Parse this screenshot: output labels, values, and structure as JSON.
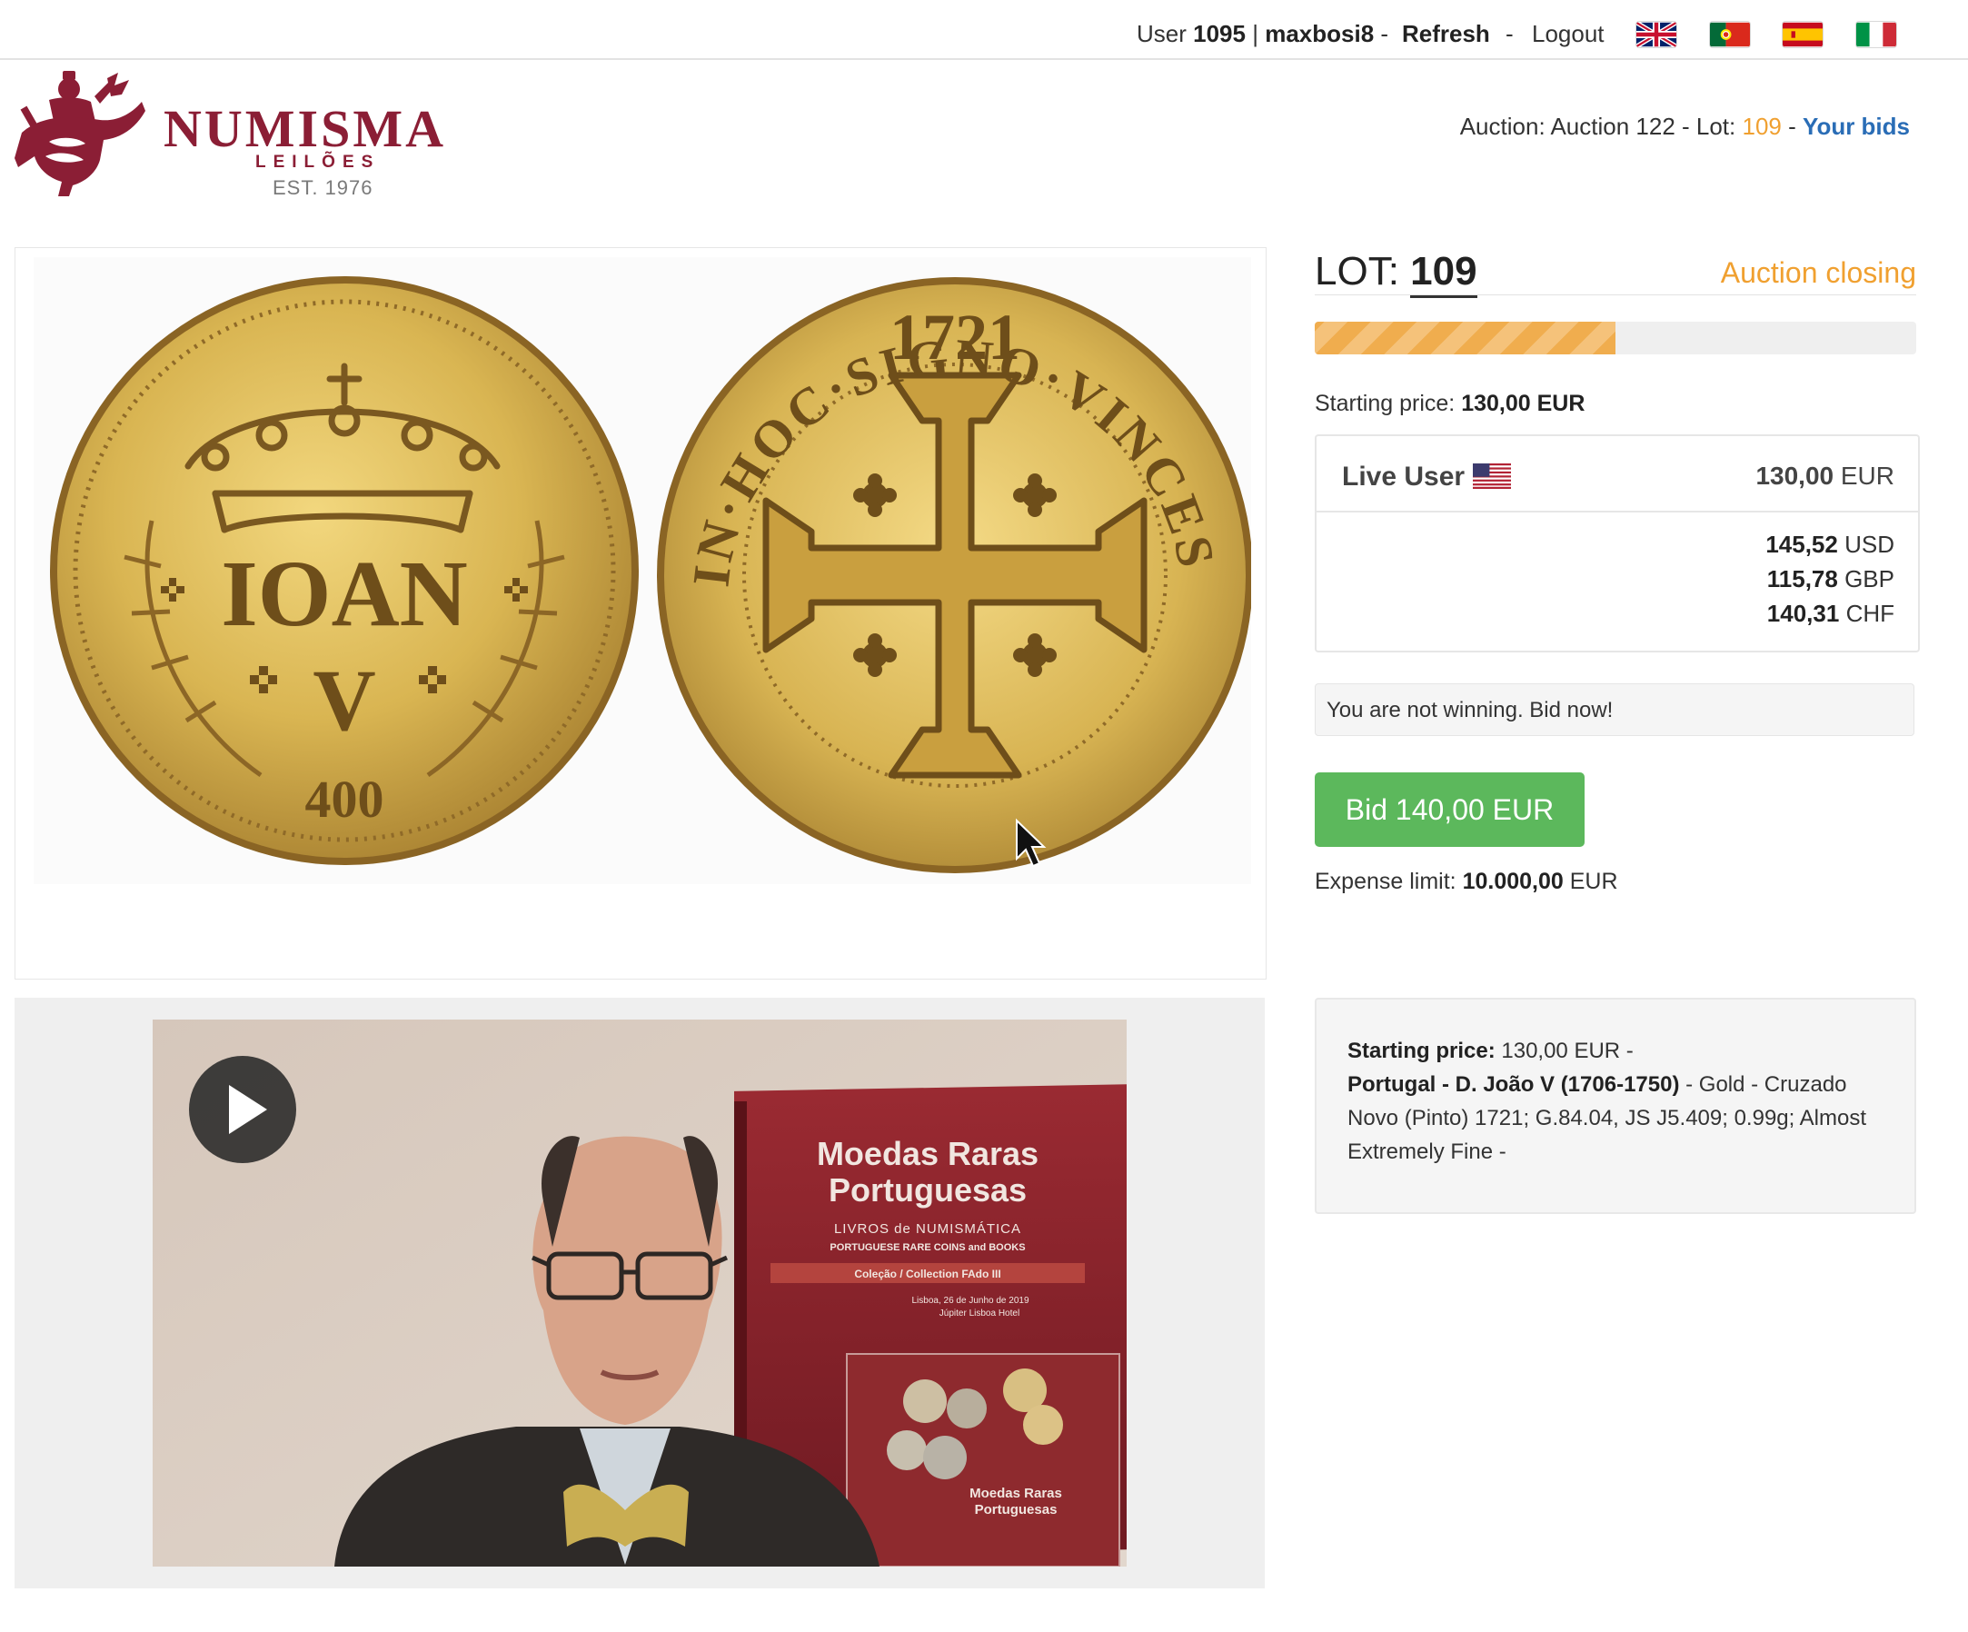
{
  "topbar": {
    "user_prefix": "User",
    "user_id": "1095",
    "separator": "|",
    "username": "maxbosi8",
    "dash1": "-",
    "refresh": "Refresh",
    "dash2": "-",
    "logout": "Logout",
    "flags": [
      "uk-flag-icon",
      "portugal-flag-icon",
      "spain-flag-icon",
      "italy-flag-icon"
    ]
  },
  "brand": {
    "name": "NUMISMA",
    "sub": "LEILÕES",
    "est": "EST. 1976",
    "color": "#8b1e35"
  },
  "auction_line": {
    "prefix": "Auction: Auction 122 - Lot:",
    "lot": "109",
    "sep": "-",
    "your_bids": "Your bids"
  },
  "lot": {
    "label": "LOT:",
    "number": "109",
    "status": "Auction closing",
    "progress": 0.5
  },
  "starting_price": {
    "label": "Starting price:",
    "value": "130,00 EUR"
  },
  "current_bid": {
    "bidder": "Live User",
    "amount": "130,00",
    "currency": "EUR",
    "conversions": [
      {
        "amount": "145,52",
        "currency": "USD"
      },
      {
        "amount": "115,78",
        "currency": "GBP"
      },
      {
        "amount": "140,31",
        "currency": "CHF"
      }
    ]
  },
  "status_message": "You are not winning. Bid now!",
  "bid_button": "Bid 140,00 EUR",
  "expense": {
    "label": "Expense limit:",
    "value": "10.000,00",
    "currency": "EUR"
  },
  "description": {
    "start_label": "Starting price:",
    "start_value": "130,00 EUR -",
    "title": "Portugal - D. João V (1706-1750)",
    "text": "- Gold - Cruzado Novo (Pinto) 1721; G.84.04, JS J5.409; 0.99g; Almost Extremely Fine -"
  },
  "coin": {
    "obverse_text": "IOAN",
    "obverse_v": "V",
    "obverse_value": "400",
    "reverse_year": "1721",
    "reverse_legend": "IN·HOC·SIGNO·VINCES"
  },
  "video": {
    "banner_title_1": "Moedas Raras",
    "banner_title_2": "Portuguesas",
    "banner_sub_1": "LIVROS de NUMISMÁTICA",
    "banner_sub_2": "PORTUGUESE RARE COINS and BOOKS",
    "banner_collection": "Coleção / Collection FAdo III",
    "banner_date": "Lisboa, 26 de Junho de 2019",
    "banner_venue": "Júpiter Lisboa Hotel",
    "book_title_1": "Moedas Raras",
    "book_title_2": "Portuguesas"
  },
  "colors": {
    "accent_orange": "#f0a030",
    "link_blue": "#2a6db6",
    "bid_green": "#5cb85c",
    "brand_red": "#8b1e35"
  }
}
